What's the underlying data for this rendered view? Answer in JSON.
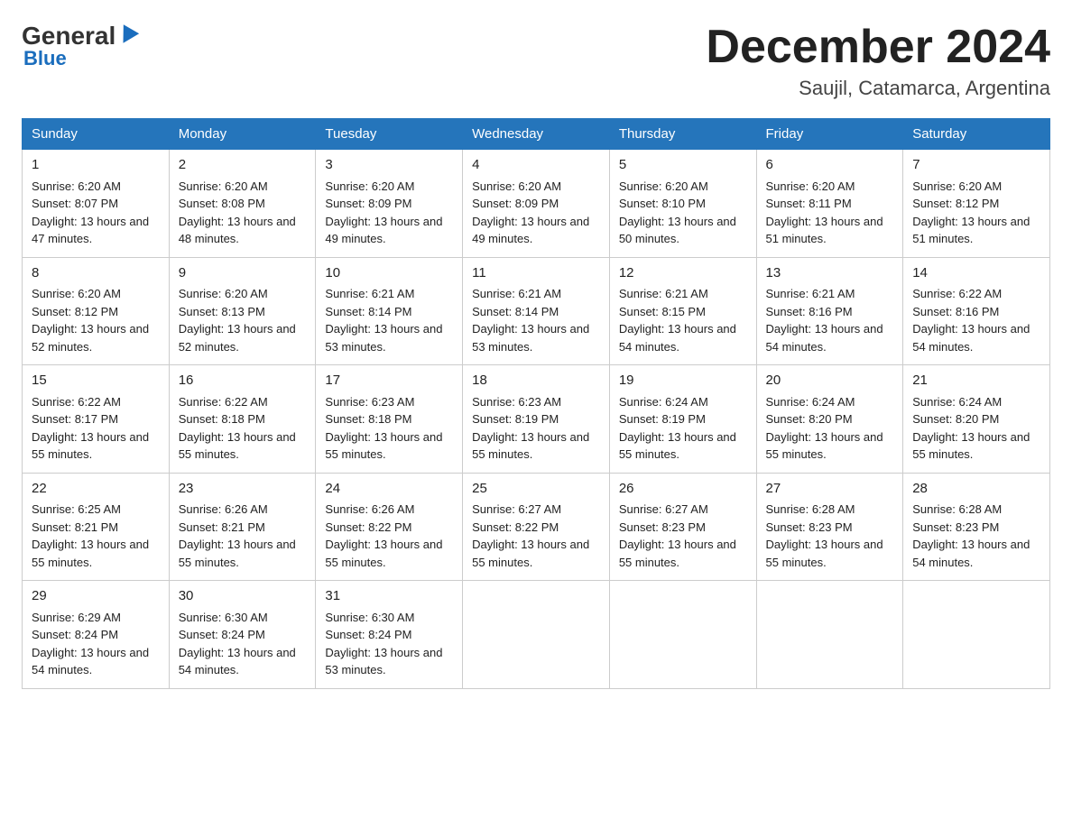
{
  "header": {
    "logo_general": "General",
    "logo_blue": "Blue",
    "month_title": "December 2024",
    "location": "Saujil, Catamarca, Argentina"
  },
  "days_of_week": [
    "Sunday",
    "Monday",
    "Tuesday",
    "Wednesday",
    "Thursday",
    "Friday",
    "Saturday"
  ],
  "weeks": [
    [
      {
        "day": "1",
        "sunrise": "6:20 AM",
        "sunset": "8:07 PM",
        "daylight": "13 hours and 47 minutes."
      },
      {
        "day": "2",
        "sunrise": "6:20 AM",
        "sunset": "8:08 PM",
        "daylight": "13 hours and 48 minutes."
      },
      {
        "day": "3",
        "sunrise": "6:20 AM",
        "sunset": "8:09 PM",
        "daylight": "13 hours and 49 minutes."
      },
      {
        "day": "4",
        "sunrise": "6:20 AM",
        "sunset": "8:09 PM",
        "daylight": "13 hours and 49 minutes."
      },
      {
        "day": "5",
        "sunrise": "6:20 AM",
        "sunset": "8:10 PM",
        "daylight": "13 hours and 50 minutes."
      },
      {
        "day": "6",
        "sunrise": "6:20 AM",
        "sunset": "8:11 PM",
        "daylight": "13 hours and 51 minutes."
      },
      {
        "day": "7",
        "sunrise": "6:20 AM",
        "sunset": "8:12 PM",
        "daylight": "13 hours and 51 minutes."
      }
    ],
    [
      {
        "day": "8",
        "sunrise": "6:20 AM",
        "sunset": "8:12 PM",
        "daylight": "13 hours and 52 minutes."
      },
      {
        "day": "9",
        "sunrise": "6:20 AM",
        "sunset": "8:13 PM",
        "daylight": "13 hours and 52 minutes."
      },
      {
        "day": "10",
        "sunrise": "6:21 AM",
        "sunset": "8:14 PM",
        "daylight": "13 hours and 53 minutes."
      },
      {
        "day": "11",
        "sunrise": "6:21 AM",
        "sunset": "8:14 PM",
        "daylight": "13 hours and 53 minutes."
      },
      {
        "day": "12",
        "sunrise": "6:21 AM",
        "sunset": "8:15 PM",
        "daylight": "13 hours and 54 minutes."
      },
      {
        "day": "13",
        "sunrise": "6:21 AM",
        "sunset": "8:16 PM",
        "daylight": "13 hours and 54 minutes."
      },
      {
        "day": "14",
        "sunrise": "6:22 AM",
        "sunset": "8:16 PM",
        "daylight": "13 hours and 54 minutes."
      }
    ],
    [
      {
        "day": "15",
        "sunrise": "6:22 AM",
        "sunset": "8:17 PM",
        "daylight": "13 hours and 55 minutes."
      },
      {
        "day": "16",
        "sunrise": "6:22 AM",
        "sunset": "8:18 PM",
        "daylight": "13 hours and 55 minutes."
      },
      {
        "day": "17",
        "sunrise": "6:23 AM",
        "sunset": "8:18 PM",
        "daylight": "13 hours and 55 minutes."
      },
      {
        "day": "18",
        "sunrise": "6:23 AM",
        "sunset": "8:19 PM",
        "daylight": "13 hours and 55 minutes."
      },
      {
        "day": "19",
        "sunrise": "6:24 AM",
        "sunset": "8:19 PM",
        "daylight": "13 hours and 55 minutes."
      },
      {
        "day": "20",
        "sunrise": "6:24 AM",
        "sunset": "8:20 PM",
        "daylight": "13 hours and 55 minutes."
      },
      {
        "day": "21",
        "sunrise": "6:24 AM",
        "sunset": "8:20 PM",
        "daylight": "13 hours and 55 minutes."
      }
    ],
    [
      {
        "day": "22",
        "sunrise": "6:25 AM",
        "sunset": "8:21 PM",
        "daylight": "13 hours and 55 minutes."
      },
      {
        "day": "23",
        "sunrise": "6:26 AM",
        "sunset": "8:21 PM",
        "daylight": "13 hours and 55 minutes."
      },
      {
        "day": "24",
        "sunrise": "6:26 AM",
        "sunset": "8:22 PM",
        "daylight": "13 hours and 55 minutes."
      },
      {
        "day": "25",
        "sunrise": "6:27 AM",
        "sunset": "8:22 PM",
        "daylight": "13 hours and 55 minutes."
      },
      {
        "day": "26",
        "sunrise": "6:27 AM",
        "sunset": "8:23 PM",
        "daylight": "13 hours and 55 minutes."
      },
      {
        "day": "27",
        "sunrise": "6:28 AM",
        "sunset": "8:23 PM",
        "daylight": "13 hours and 55 minutes."
      },
      {
        "day": "28",
        "sunrise": "6:28 AM",
        "sunset": "8:23 PM",
        "daylight": "13 hours and 54 minutes."
      }
    ],
    [
      {
        "day": "29",
        "sunrise": "6:29 AM",
        "sunset": "8:24 PM",
        "daylight": "13 hours and 54 minutes."
      },
      {
        "day": "30",
        "sunrise": "6:30 AM",
        "sunset": "8:24 PM",
        "daylight": "13 hours and 54 minutes."
      },
      {
        "day": "31",
        "sunrise": "6:30 AM",
        "sunset": "8:24 PM",
        "daylight": "13 hours and 53 minutes."
      },
      null,
      null,
      null,
      null
    ]
  ]
}
